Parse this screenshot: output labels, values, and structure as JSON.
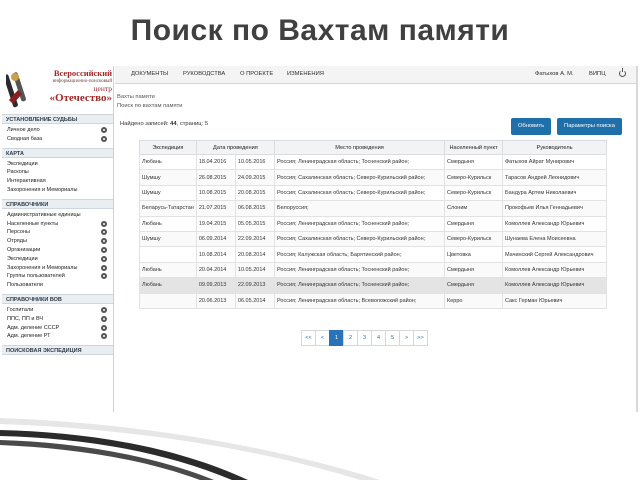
{
  "slide": {
    "title": "Поиск по Вахтам памяти"
  },
  "logo": {
    "line1": "Всероссийский",
    "line2": "информационно-поисковый",
    "line3": "центр",
    "line4": "«Отечество»"
  },
  "sidebar": {
    "sections": [
      {
        "title": "УСТАНОВЛЕНИЕ СУДЬБЫ",
        "items": [
          {
            "label": "Личное дело",
            "gear": true
          },
          {
            "label": "Сводная база",
            "gear": true
          }
        ]
      },
      {
        "title": "КАРТА",
        "items": [
          {
            "label": "Экспедиции",
            "gear": false
          },
          {
            "label": "Раскопы",
            "gear": false
          },
          {
            "label": "Интерактивная",
            "gear": false
          },
          {
            "label": "Захоронения и Мемориалы",
            "gear": false
          }
        ]
      },
      {
        "title": "СПРАВОЧНИКИ",
        "items": [
          {
            "label": "Административные единицы",
            "gear": false
          },
          {
            "label": "Населенные пункты",
            "gear": true
          },
          {
            "label": "Персоны",
            "gear": true
          },
          {
            "label": "Отряды",
            "gear": true
          },
          {
            "label": "Организации",
            "gear": true
          },
          {
            "label": "Экспедиции",
            "gear": true
          },
          {
            "label": "Захоронения и Мемориалы",
            "gear": true
          },
          {
            "label": "Группы пользователей",
            "gear": true
          },
          {
            "label": "Пользователи",
            "gear": false
          }
        ]
      },
      {
        "title": "СПРАВОЧНИКИ ВОВ",
        "items": [
          {
            "label": "Госпитали",
            "gear": true
          },
          {
            "label": "ППС, ПП и ВЧ",
            "gear": true
          },
          {
            "label": "Адм. деление СССР",
            "gear": true
          },
          {
            "label": "Адм. деление РТ",
            "gear": true
          }
        ]
      },
      {
        "title": "ПОИСКОВАЯ ЭКСПЕДИЦИЯ",
        "items": []
      }
    ]
  },
  "topnav": {
    "items": [
      "ДОКУМЕНТЫ",
      "РУКОВОДСТВА",
      "О ПРОЕКТЕ",
      "ИЗМЕНЕНИЯ"
    ],
    "user": "Фатыхов А. М.",
    "org": "ВИПЦ"
  },
  "breadcrumb": {
    "l1": "Вахты памяти",
    "l2": "Поиск по вахтам памяти"
  },
  "summary": {
    "prefix": "Найдено записей:",
    "count": "44",
    "mid": ", страниц:",
    "pages": "5"
  },
  "buttons": {
    "refresh": "Обновить",
    "params": "Параметры поиска"
  },
  "table": {
    "headers": [
      "Экспедиция",
      "Дата проведения",
      "",
      "Место проведения",
      "Населенный пункт",
      "Руководитель"
    ],
    "rows": [
      [
        "Любань",
        "18.04.2016",
        "10.05.2016",
        "Россия; Ленинградская область; Тосненский район;",
        "Смердыня",
        "Фатыхов Айрат Мунирович"
      ],
      [
        "Шумшу",
        "26.08.2015",
        "24.09.2015",
        "Россия; Сахалинская область; Северо-Курильский район;",
        "Северо-Курильск",
        "Тарасов Андрей Леонидович"
      ],
      [
        "Шумшу",
        "10.08.2015",
        "20.08.2015",
        "Россия; Сахалинская область; Северо-Курильский район;",
        "Северо-Курильск",
        "Бандура Артем Николаевич"
      ],
      [
        "Беларусь-Татарстан",
        "21.07.2015",
        "06.08.2015",
        "Белоруссия;",
        "Слоним",
        "Прокофьев Илья Геннадьевич"
      ],
      [
        "Любань",
        "19.04.2015",
        "05.05.2015",
        "Россия; Ленинградская область; Тосненский район;",
        "Смердыня",
        "Комоллев Александр Юрьевич"
      ],
      [
        "Шумшу",
        "06.09.2014",
        "22.09.2014",
        "Россия; Сахалинская область; Северо-Курильский район;",
        "Северо-Курильск",
        "Шунаева Елена Моисеевна"
      ],
      [
        "",
        "10.08.2014",
        "20.08.2014",
        "Россия; Калужская область; Барятинский район;",
        "Цветовка",
        "Мачинский Сергей Александрович"
      ],
      [
        "Любань",
        "20.04.2014",
        "10.05.2014",
        "Россия; Ленинградская область; Тосненский район;",
        "Смердыня",
        "Комоллев Александр Юрьевич"
      ],
      [
        "Любань",
        "09.09.2013",
        "22.09.2013",
        "Россия; Ленинградская область; Тосненский район;",
        "Смердыня",
        "Комоллев Александр Юрьевич"
      ],
      [
        "",
        "20.06.2013",
        "06.05.2014",
        "Россия; Ленинградская область; Всеволожский район;",
        "Керро",
        "Сакс Герман Юрьевич"
      ]
    ],
    "selected_row": 8
  },
  "pager": [
    "<<",
    "<",
    "1",
    "2",
    "3",
    "4",
    "5",
    ">",
    ">>"
  ],
  "colors": {
    "accent": "#1e6faa",
    "link": "#2f6fb5",
    "logo": "#a0282a"
  }
}
